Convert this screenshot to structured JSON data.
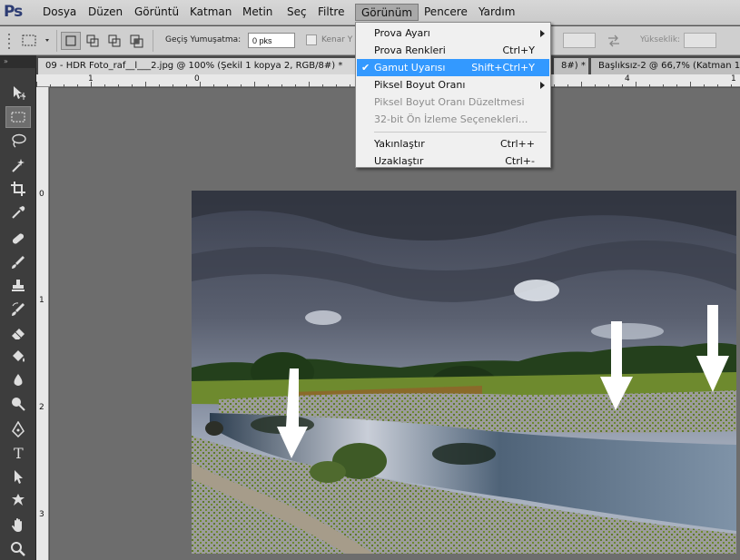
{
  "app": {
    "logo": "Ps"
  },
  "menubar": {
    "items": [
      "Dosya",
      "Düzen",
      "Görüntü",
      "Katman",
      "Metin",
      "Seç",
      "Filtre",
      "Görünüm",
      "Pencere",
      "Yardım"
    ],
    "active": "Görünüm"
  },
  "options": {
    "feather_label": "Geçiş Yumuşatma:",
    "feather_value": "0 pks",
    "antialias_label": "Kenar Y",
    "height_label": "Yükseklik:"
  },
  "tabs": [
    {
      "label": "09 - HDR Foto_raf__l___2.jpg @ 100% (Şekil 1 kopya 2, RGB/8#) *",
      "active": true
    },
    {
      "label": "8#) * ×",
      "active": false
    },
    {
      "label": "Başlıksız-2 @ 66,7% (Katman 1",
      "active": false
    }
  ],
  "ruler_top": [
    "1",
    "0",
    "4",
    "1"
  ],
  "ruler_left": [
    "0",
    "1",
    "2",
    "3"
  ],
  "view_menu": {
    "items": [
      {
        "label": "Prova Ayarı",
        "shortcut": "",
        "submenu": true,
        "checked": false,
        "disabled": false,
        "highlight": false
      },
      {
        "label": "Prova Renkleri",
        "shortcut": "Ctrl+Y",
        "submenu": false,
        "checked": false,
        "disabled": false,
        "highlight": false
      },
      {
        "label": "Gamut Uyarısı",
        "shortcut": "Shift+Ctrl+Y",
        "submenu": false,
        "checked": true,
        "disabled": false,
        "highlight": true
      },
      {
        "label": "Piksel Boyut Oranı",
        "shortcut": "",
        "submenu": true,
        "checked": false,
        "disabled": false,
        "highlight": false
      },
      {
        "label": "Piksel Boyut Oranı Düzeltmesi",
        "shortcut": "",
        "submenu": false,
        "checked": false,
        "disabled": true,
        "highlight": false
      },
      {
        "label": "32-bit Ön İzleme Seçenekleri...",
        "shortcut": "",
        "submenu": false,
        "checked": false,
        "disabled": true,
        "highlight": false
      },
      {
        "label": "Yakınlaştır",
        "shortcut": "Ctrl++",
        "submenu": false,
        "checked": false,
        "disabled": false,
        "highlight": false
      },
      {
        "label": "Uzaklaştır",
        "shortcut": "Ctrl+-",
        "submenu": false,
        "checked": false,
        "disabled": false,
        "highlight": false
      }
    ],
    "check_glyph": "✔"
  },
  "colors": {
    "highlight": "#3399ff",
    "gamut_warning": "#9c9c9c",
    "menu_bg": "#f0f0f0"
  },
  "tools": [
    "move-icon",
    "marquee-icon",
    "lasso-icon",
    "magic-wand-icon",
    "crop-icon",
    "eyedropper-icon",
    "healing-brush-icon",
    "brush-icon",
    "clone-stamp-icon",
    "history-brush-icon",
    "eraser-icon",
    "paint-bucket-icon",
    "blur-icon",
    "dodge-icon",
    "pen-icon",
    "type-icon",
    "path-selection-icon",
    "shape-icon",
    "hand-icon",
    "zoom-icon"
  ]
}
